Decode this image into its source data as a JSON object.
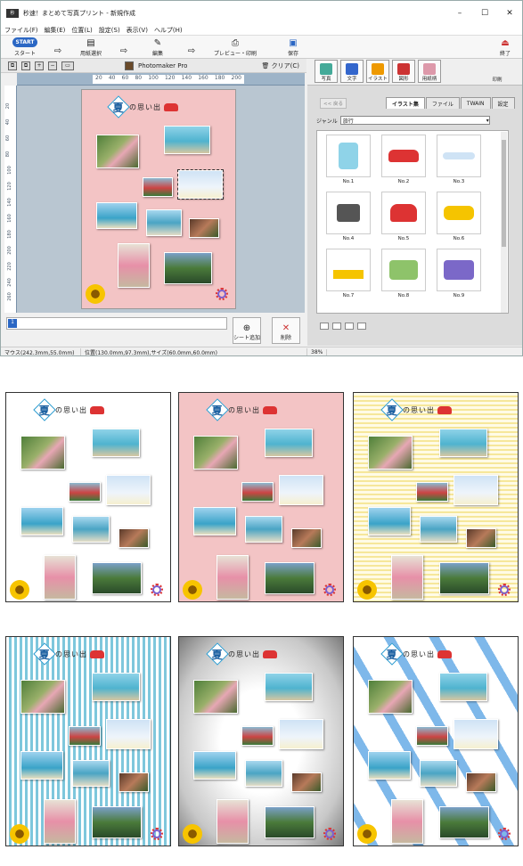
{
  "window": {
    "title": "秒速！まとめて写真プリント - 新規作成",
    "controls": [
      "–",
      "☐",
      "✕"
    ]
  },
  "menu": [
    "ファイル(F)",
    "編集(E)",
    "位置(L)",
    "設定(S)",
    "表示(V)",
    "ヘルプ(H)"
  ],
  "toolbar": {
    "start": "START",
    "start_label": "スタート",
    "paper_select": "用紙選択",
    "edit": "編集",
    "preview_print": "プレビュー・印刷",
    "save": "保存",
    "exit": "終了"
  },
  "subbar": {
    "app_name": "Photomaker Pro",
    "clear": "クリア(C)"
  },
  "ruler": {
    "h": [
      "20",
      "40",
      "60",
      "80",
      "100",
      "120",
      "140",
      "160",
      "180",
      "200"
    ],
    "v": [
      "20",
      "40",
      "60",
      "80",
      "100",
      "120",
      "140",
      "160",
      "180",
      "200",
      "220",
      "240",
      "260",
      "280"
    ]
  },
  "heading": {
    "kanji": "夏",
    "text": "の思い出"
  },
  "sheet": {
    "number": "1",
    "add": "シート追加",
    "delete": "削除"
  },
  "status": {
    "mouse": "マウス(242.3mm,55.0mm)",
    "position": "位置(130.0mm,97.3mm),サイズ(60.0mm,60.0mm)",
    "zoom": "38%"
  },
  "right_panel": {
    "tools": [
      "写真",
      "文字",
      "イラスト",
      "図形",
      "用紙柄"
    ],
    "print": "印刷",
    "back": "<< 戻る",
    "tabs": [
      "イラスト集",
      "ファイル",
      "TWAIN",
      "設定"
    ],
    "genre_label": "ジャンル",
    "genre_value": "旅行",
    "items": [
      "No.1",
      "No.2",
      "No.3",
      "No.4",
      "No.5",
      "No.6",
      "No.7",
      "No.8",
      "No.9"
    ]
  },
  "colors": {
    "accent": "#2b67c4",
    "page_pink": "#f3c4c5",
    "canvas": "#b9c6d1",
    "yellow_stripe": "#f6e79a",
    "blue_stripe": "#7ec7dc"
  }
}
